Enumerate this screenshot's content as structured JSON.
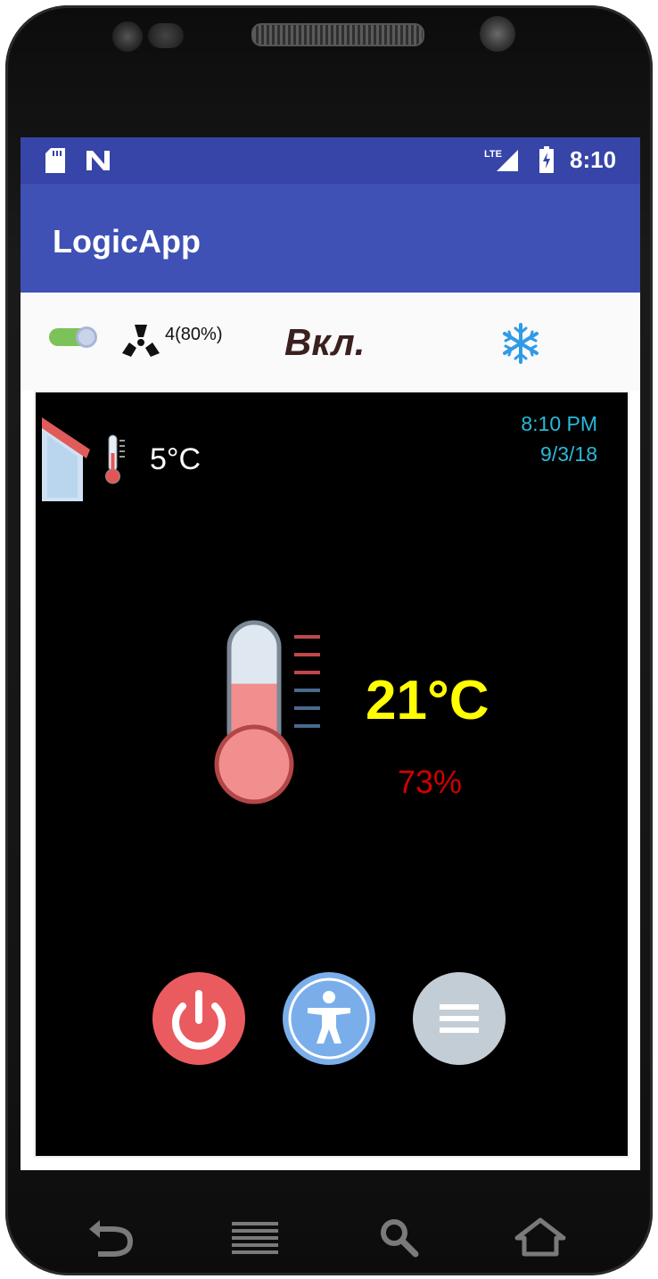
{
  "status_bar": {
    "time": "8:10",
    "icons": [
      "sd-card-icon",
      "n-icon",
      "lte-signal-icon",
      "battery-charging-icon"
    ]
  },
  "app_bar": {
    "title": "LogicApp"
  },
  "controls": {
    "toggle_on": true,
    "fan_speed": "4(80%)",
    "mode": "Вкл.",
    "mode_icon": "snowflake-icon"
  },
  "panel": {
    "outdoor_temp": "5°C",
    "time": "8:10 PM",
    "date": "9/3/18",
    "indoor_temp": "21°C",
    "humidity": "73%",
    "thermometer_level": 0.55,
    "buttons": [
      "power-button",
      "accessibility-button",
      "menu-button"
    ]
  },
  "nav_keys": [
    "back-key",
    "menu-key",
    "search-key",
    "home-key"
  ],
  "colors": {
    "status_bar": "#3645a7",
    "app_bar": "#3f51b5",
    "indoor_temp": "#ffff00",
    "humidity": "#d00000",
    "time_date": "#29b9d8",
    "power": "#ea5b5f",
    "accessibility": "#7aaeea",
    "menu": "#c3cdd6"
  }
}
